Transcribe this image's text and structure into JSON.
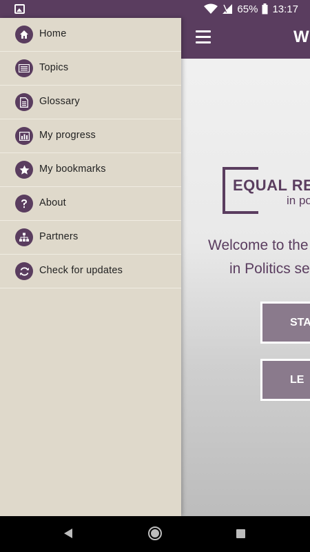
{
  "status_bar": {
    "battery": "65%",
    "time": "13:17"
  },
  "app": {
    "title": "W",
    "logo_line1": "EQUAL RE",
    "logo_line2": "in po",
    "welcome_line1": "Welcome to the",
    "welcome_line2": "in Politics se",
    "start_button": "STA",
    "learn_button": "LE"
  },
  "drawer": {
    "items": [
      {
        "label": "Home",
        "icon": "home-icon"
      },
      {
        "label": "Topics",
        "icon": "list-icon"
      },
      {
        "label": "Glossary",
        "icon": "document-icon"
      },
      {
        "label": "My progress",
        "icon": "bar-chart-icon"
      },
      {
        "label": "My bookmarks",
        "icon": "star-icon"
      },
      {
        "label": "About",
        "icon": "question-icon"
      },
      {
        "label": "Partners",
        "icon": "org-chart-icon"
      },
      {
        "label": "Check for updates",
        "icon": "refresh-icon"
      }
    ]
  },
  "colors": {
    "brand": "#5a3d5f",
    "drawer_bg": "#dfd9cb",
    "button_bg": "#8a7a8c"
  }
}
